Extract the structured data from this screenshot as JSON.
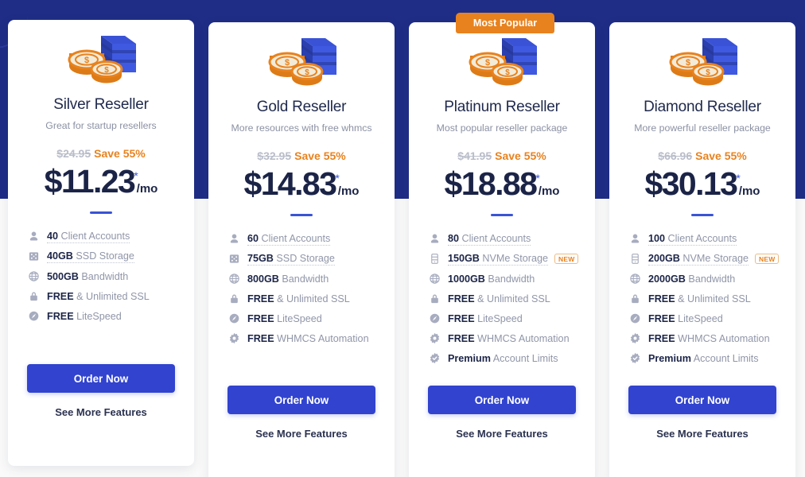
{
  "theme": {
    "band_blue": "#1f2d86",
    "accent_blue": "#3143cf",
    "accent_orange": "#e8821e",
    "page_bg": "#fafafa",
    "card_bg": "#ffffff",
    "heading_color": "#1b2447",
    "muted_color": "#9096a8"
  },
  "popular_badge": {
    "label": "Most Popular"
  },
  "labels": {
    "order": "Order Now",
    "more": "See More Features",
    "new": "NEW",
    "per_month": "/mo",
    "star": "*"
  },
  "plans": [
    {
      "name": "Silver Reseller",
      "desc": "Great for startup resellers",
      "old_price": "$24.95",
      "save": "Save 55%",
      "price": "$11.23",
      "per": "/mo",
      "highlighted": false,
      "order_label": "Order Now",
      "more_label": "See More Features",
      "features": [
        {
          "icon": "user-icon",
          "strong": "40",
          "rest": " Client Accounts",
          "dotted": true,
          "badge": ""
        },
        {
          "icon": "ssd-chip-icon",
          "strong": "40GB",
          "rest": " SSD Storage",
          "dotted": true,
          "badge": ""
        },
        {
          "icon": "globe-icon",
          "strong": "500GB",
          "rest": " Bandwidth",
          "dotted": false,
          "badge": ""
        },
        {
          "icon": "lock-icon",
          "strong": "FREE",
          "rest": " & Unlimited SSL",
          "dotted": false,
          "badge": ""
        },
        {
          "icon": "speedometer-icon",
          "strong": "FREE",
          "rest": " LiteSpeed",
          "dotted": false,
          "badge": ""
        }
      ]
    },
    {
      "name": "Gold Reseller",
      "desc": "More resources with free whmcs",
      "old_price": "$32.95",
      "save": "Save 55%",
      "price": "$14.83",
      "per": "/mo",
      "highlighted": false,
      "order_label": "Order Now",
      "more_label": "See More Features",
      "features": [
        {
          "icon": "user-icon",
          "strong": "60",
          "rest": " Client Accounts",
          "dotted": true,
          "badge": ""
        },
        {
          "icon": "ssd-chip-icon",
          "strong": "75GB",
          "rest": " SSD Storage",
          "dotted": true,
          "badge": ""
        },
        {
          "icon": "globe-icon",
          "strong": "800GB",
          "rest": " Bandwidth",
          "dotted": false,
          "badge": ""
        },
        {
          "icon": "lock-icon",
          "strong": "FREE",
          "rest": " & Unlimited SSL",
          "dotted": false,
          "badge": ""
        },
        {
          "icon": "speedometer-icon",
          "strong": "FREE",
          "rest": " LiteSpeed",
          "dotted": false,
          "badge": ""
        },
        {
          "icon": "gear-icon",
          "strong": "FREE",
          "rest": " WHMCS Automation",
          "dotted": false,
          "badge": ""
        }
      ]
    },
    {
      "name": "Platinum Reseller",
      "desc": "Most popular reseller package",
      "old_price": "$41.95",
      "save": "Save 55%",
      "price": "$18.88",
      "per": "/mo",
      "highlighted": true,
      "order_label": "Order Now",
      "more_label": "See More Features",
      "features": [
        {
          "icon": "user-icon",
          "strong": "80",
          "rest": " Client Accounts",
          "dotted": true,
          "badge": ""
        },
        {
          "icon": "nvme-drive-icon",
          "strong": "150GB",
          "rest": " NVMe Storage",
          "dotted": true,
          "badge": "NEW"
        },
        {
          "icon": "globe-icon",
          "strong": "1000GB",
          "rest": " Bandwidth",
          "dotted": false,
          "badge": ""
        },
        {
          "icon": "lock-icon",
          "strong": "FREE",
          "rest": " & Unlimited SSL",
          "dotted": false,
          "badge": ""
        },
        {
          "icon": "speedometer-icon",
          "strong": "FREE",
          "rest": " LiteSpeed",
          "dotted": false,
          "badge": ""
        },
        {
          "icon": "gear-icon",
          "strong": "FREE",
          "rest": " WHMCS Automation",
          "dotted": false,
          "badge": ""
        },
        {
          "icon": "gear-check-icon",
          "strong": "Premium",
          "rest": " Account Limits",
          "dotted": false,
          "badge": ""
        }
      ]
    },
    {
      "name": "Diamond Reseller",
      "desc": "More powerful reseller package",
      "old_price": "$66.96",
      "save": "Save 55%",
      "price": "$30.13",
      "per": "/mo",
      "highlighted": false,
      "order_label": "Order Now",
      "more_label": "See More Features",
      "features": [
        {
          "icon": "user-icon",
          "strong": "100",
          "rest": " Client Accounts",
          "dotted": true,
          "badge": ""
        },
        {
          "icon": "nvme-drive-icon",
          "strong": "200GB",
          "rest": " NVMe Storage",
          "dotted": true,
          "badge": "NEW"
        },
        {
          "icon": "globe-icon",
          "strong": "2000GB",
          "rest": " Bandwidth",
          "dotted": false,
          "badge": ""
        },
        {
          "icon": "lock-icon",
          "strong": "FREE",
          "rest": " & Unlimited SSL",
          "dotted": false,
          "badge": ""
        },
        {
          "icon": "speedometer-icon",
          "strong": "FREE",
          "rest": " LiteSpeed",
          "dotted": false,
          "badge": ""
        },
        {
          "icon": "gear-icon",
          "strong": "FREE",
          "rest": " WHMCS Automation",
          "dotted": false,
          "badge": ""
        },
        {
          "icon": "gear-check-icon",
          "strong": "Premium",
          "rest": " Account Limits",
          "dotted": false,
          "badge": ""
        }
      ]
    }
  ]
}
